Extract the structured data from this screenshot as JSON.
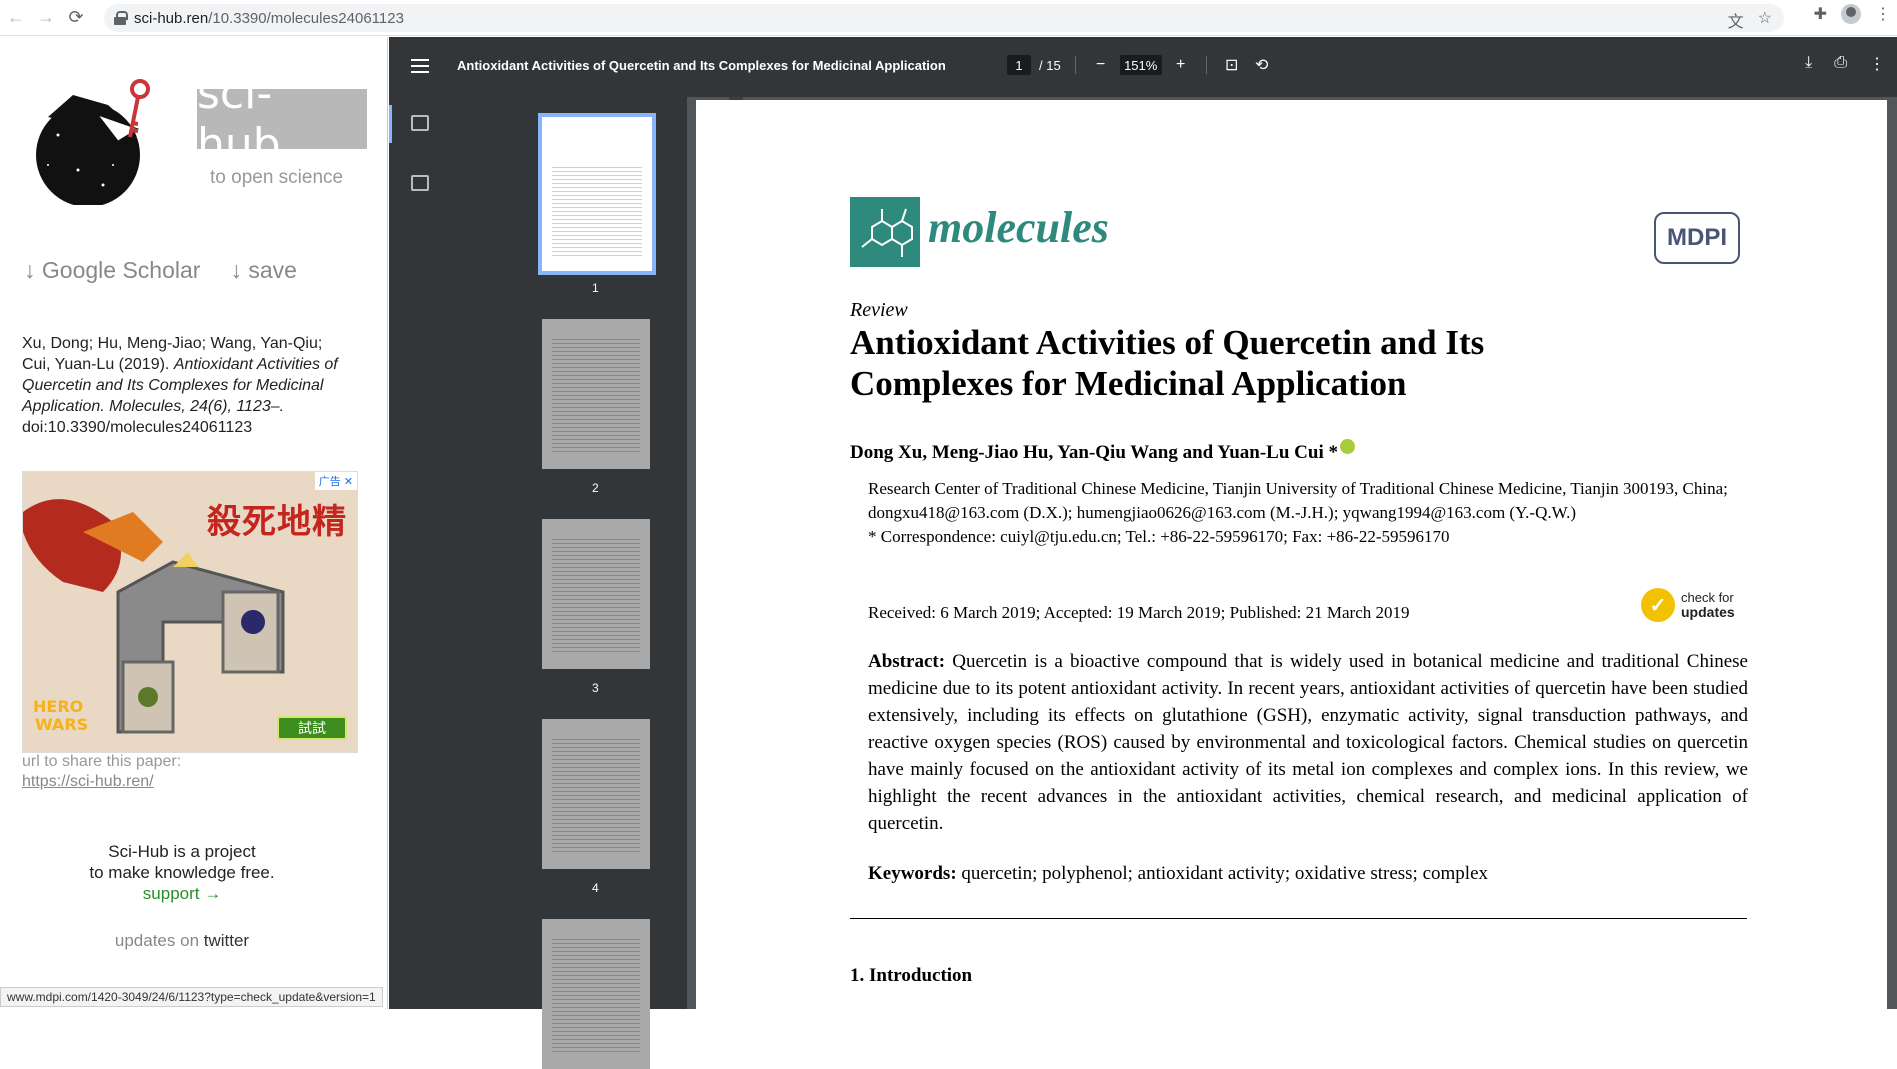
{
  "browser": {
    "url_host": "sci-hub.ren",
    "url_path": "/10.3390/molecules24061123"
  },
  "scihub": {
    "brand": "sci-hub",
    "tagline": "to open science",
    "google_scholar": "↓ Google Scholar",
    "save": "↓ save",
    "citation_authors": "Xu, Dong; Hu, Meng-Jiao; Wang, Yan-Qiu; Cui, Yuan-Lu (2019). ",
    "citation_italic": "Antioxidant Activities of Quercetin and Its Complexes for Medicinal Application. Molecules, 24(6), 1123–.",
    "citation_doi": "doi:10.3390/molecules24061123",
    "ad_text": "殺死地精",
    "ad_badge": "广告 ✕",
    "ad_button": "試試",
    "share_label": "url to share this paper:",
    "share_url": "https://sci-hub.ren/",
    "mission_line1": "Sci-Hub is a project",
    "mission_line2": "to make knowledge free.",
    "support": "support →",
    "updates_prefix": "updates on ",
    "updates_link": "twitter"
  },
  "pdf_toolbar": {
    "title": "Antioxidant Activities of Quercetin and Its Complexes for Medicinal Application",
    "page_current": "1",
    "page_total": "/ 15",
    "zoom": "151%"
  },
  "thumbnails": [
    "1",
    "2",
    "3",
    "4"
  ],
  "paper": {
    "journal": "molecules",
    "publisher": "MDPI",
    "type": "Review",
    "title": "Antioxidant Activities of Quercetin and Its Complexes for Medicinal Application",
    "authors": "Dong Xu, Meng-Jiao Hu, Yan-Qiu Wang and Yuan-Lu Cui *",
    "affiliation": "Research Center of Traditional Chinese Medicine, Tianjin University of Traditional Chinese Medicine, Tianjin 300193, China; dongxu418@163.com (D.X.); humengjiao0626@163.com (M.-J.H.); yqwang1994@163.com (Y.-Q.W.)",
    "correspondence": "*  Correspondence: cuiyl@tju.edu.cn; Tel.: +86-22-59596170; Fax: +86-22-59596170",
    "dates": "Received: 6 March 2019; Accepted: 19 March 2019; Published: 21 March 2019",
    "check_line1": "check for",
    "check_line2": "updates",
    "abstract_label": "Abstract:",
    "abstract": " Quercetin is a bioactive compound that is widely used in botanical medicine and traditional Chinese medicine due to its potent antioxidant activity.  In recent years, antioxidant activities of quercetin have been studied extensively, including its effects on glutathione (GSH), enzymatic activity, signal transduction pathways, and reactive oxygen species (ROS) caused by environmental and toxicological factors. Chemical studies on quercetin have mainly focused on the antioxidant activity of its metal ion complexes and complex ions. In this review, we highlight the recent advances in the antioxidant activities, chemical research, and medicinal application of quercetin.",
    "keywords_label": "Keywords:",
    "keywords": " quercetin; polyphenol; antioxidant activity; oxidative stress; complex",
    "section1": "1. Introduction"
  },
  "status_bar": "www.mdpi.com/1420-3049/24/6/1123?type=check_update&version=1"
}
